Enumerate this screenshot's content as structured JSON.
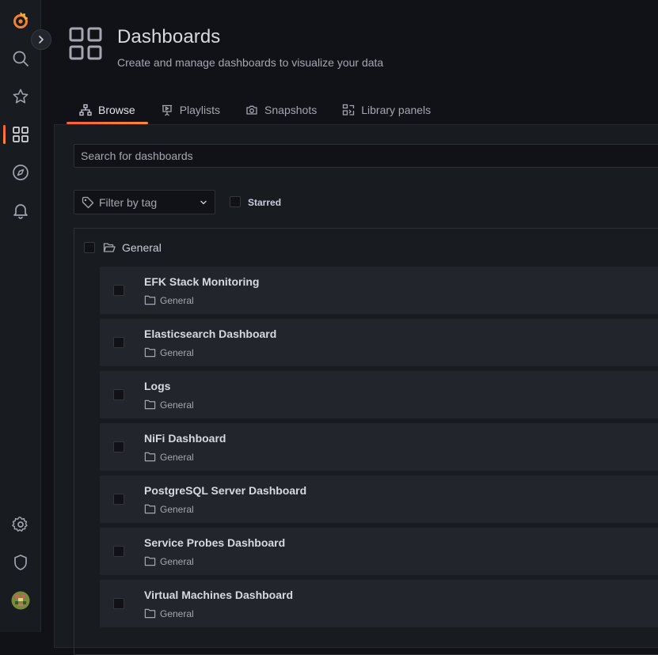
{
  "header": {
    "title": "Dashboards",
    "subtitle": "Create and manage dashboards to visualize your data"
  },
  "sidebar": {
    "items": [
      {
        "icon": "grafana-logo-icon"
      },
      {
        "icon": "search-icon"
      },
      {
        "icon": "star-icon"
      },
      {
        "icon": "dashboards-icon",
        "active": true
      },
      {
        "icon": "compass-icon"
      },
      {
        "icon": "bell-icon"
      },
      {
        "icon": "gear-icon"
      },
      {
        "icon": "shield-icon"
      },
      {
        "icon": "avatar"
      }
    ]
  },
  "tabs": [
    {
      "label": "Browse",
      "icon": "sitemap-icon",
      "active": true
    },
    {
      "label": "Playlists",
      "icon": "presentation-icon"
    },
    {
      "label": "Snapshots",
      "icon": "camera-icon"
    },
    {
      "label": "Library panels",
      "icon": "library-panel-icon"
    }
  ],
  "search": {
    "placeholder": "Search for dashboards"
  },
  "filter": {
    "label": "Filter by tag"
  },
  "starred": {
    "label": "Starred"
  },
  "folder": {
    "label": "General"
  },
  "dashboards": [
    {
      "title": "EFK Stack Monitoring",
      "folder": "General"
    },
    {
      "title": "Elasticsearch Dashboard",
      "folder": "General"
    },
    {
      "title": "Logs",
      "folder": "General"
    },
    {
      "title": "NiFi Dashboard",
      "folder": "General"
    },
    {
      "title": "PostgreSQL Server Dashboard",
      "folder": "General"
    },
    {
      "title": "Service Probes Dashboard",
      "folder": "General"
    },
    {
      "title": "Virtual Machines Dashboard",
      "folder": "General"
    }
  ],
  "colors": {
    "accent": "#ff8833",
    "accent_start": "#f55f3e",
    "background": "#111217",
    "panel": "#181b1f",
    "row": "#22252b"
  }
}
